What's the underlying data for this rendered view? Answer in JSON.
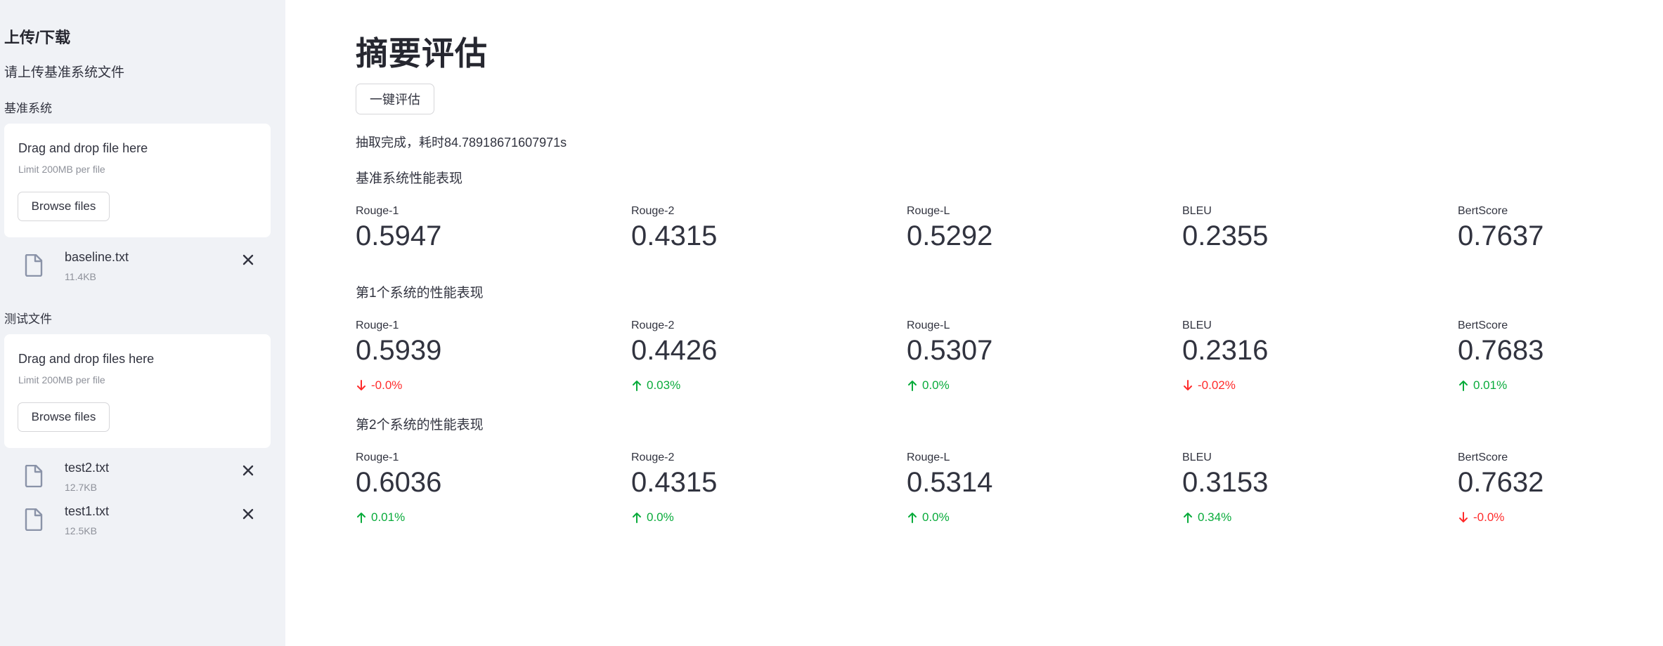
{
  "sidebar": {
    "title": "上传/下载",
    "subtitle": "请上传基准系统文件",
    "baseline_label": "基准系统",
    "test_label": "测试文件",
    "baseline_uploader": {
      "drop_text": "Drag and drop file here",
      "limit_text": "Limit 200MB per file",
      "browse_label": "Browse files"
    },
    "test_uploader": {
      "drop_text": "Drag and drop files here",
      "limit_text": "Limit 200MB per file",
      "browse_label": "Browse files"
    },
    "baseline_files": [
      {
        "name": "baseline.txt",
        "size": "11.4KB"
      }
    ],
    "test_files": [
      {
        "name": "test2.txt",
        "size": "12.7KB"
      },
      {
        "name": "test1.txt",
        "size": "12.5KB"
      }
    ]
  },
  "main": {
    "title": "摘要评估",
    "eval_button": "一键评估",
    "status": "抽取完成，耗时84.78918671607971s",
    "sections": [
      {
        "label": "基准系统性能表现",
        "metrics": [
          {
            "label": "Rouge-1",
            "value": "0.5947"
          },
          {
            "label": "Rouge-2",
            "value": "0.4315"
          },
          {
            "label": "Rouge-L",
            "value": "0.5292"
          },
          {
            "label": "BLEU",
            "value": "0.2355"
          },
          {
            "label": "BertScore",
            "value": "0.7637"
          }
        ]
      },
      {
        "label": "第1个系统的性能表现",
        "metrics": [
          {
            "label": "Rouge-1",
            "value": "0.5939",
            "delta": "-0.0%",
            "direction": "down"
          },
          {
            "label": "Rouge-2",
            "value": "0.4426",
            "delta": "0.03%",
            "direction": "up"
          },
          {
            "label": "Rouge-L",
            "value": "0.5307",
            "delta": "0.0%",
            "direction": "up"
          },
          {
            "label": "BLEU",
            "value": "0.2316",
            "delta": "-0.02%",
            "direction": "down"
          },
          {
            "label": "BertScore",
            "value": "0.7683",
            "delta": "0.01%",
            "direction": "up"
          }
        ]
      },
      {
        "label": "第2个系统的性能表现",
        "metrics": [
          {
            "label": "Rouge-1",
            "value": "0.6036",
            "delta": "0.01%",
            "direction": "up"
          },
          {
            "label": "Rouge-2",
            "value": "0.4315",
            "delta": "0.0%",
            "direction": "up"
          },
          {
            "label": "Rouge-L",
            "value": "0.5314",
            "delta": "0.0%",
            "direction": "up"
          },
          {
            "label": "BLEU",
            "value": "0.3153",
            "delta": "0.34%",
            "direction": "up"
          },
          {
            "label": "BertScore",
            "value": "0.7632",
            "delta": "-0.0%",
            "direction": "down"
          }
        ]
      }
    ]
  },
  "colors": {
    "sidebar_bg": "#f0f2f6",
    "delta_up": "#09ab3b",
    "delta_down": "#ff2b2b",
    "text": "#31333f"
  }
}
